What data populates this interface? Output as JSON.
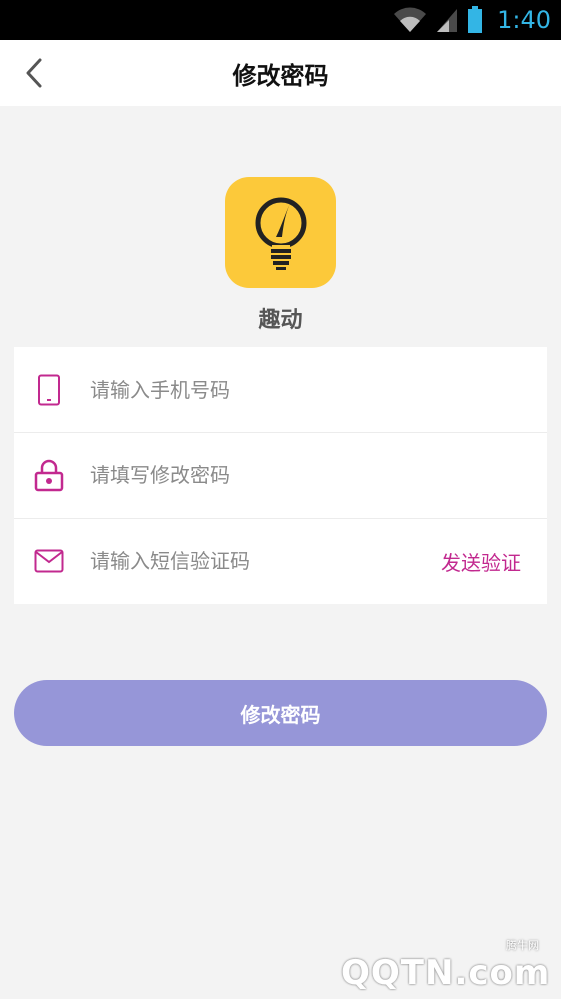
{
  "status_bar": {
    "time": "1:40"
  },
  "nav": {
    "title": "修改密码"
  },
  "app": {
    "name": "趣动"
  },
  "form": {
    "phone_placeholder": "请输入手机号码",
    "password_placeholder": "请填写修改密码",
    "code_placeholder": "请输入短信验证码",
    "send_code_label": "发送验证"
  },
  "submit": {
    "label": "修改密码"
  },
  "watermark": {
    "logo": "QQTN.com",
    "small": "腾牛网"
  },
  "colors": {
    "accent": "#c2298f",
    "button": "#9696d8",
    "logo_bg": "#fcc93a",
    "status_icons": "#33b5e5"
  },
  "icons": [
    "wifi-icon",
    "signal-icon",
    "battery-icon",
    "back-icon",
    "lightbulb-icon",
    "phone-icon",
    "lock-icon",
    "mail-icon"
  ]
}
